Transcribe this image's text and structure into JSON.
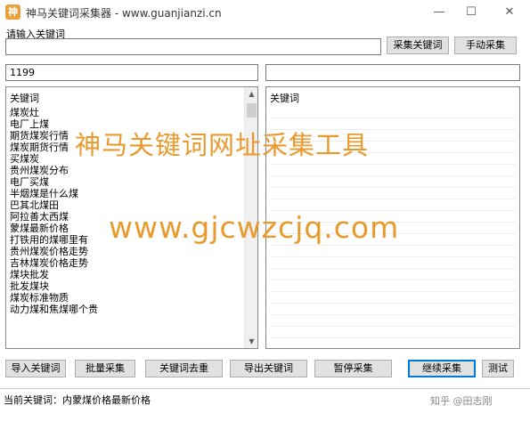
{
  "window": {
    "title": "神马关键词采集器 - www.guanjianzi.cn",
    "icon_glyph": "神",
    "minimize": "—",
    "maximize": "☐",
    "close": "✕"
  },
  "input_section": {
    "label": "请输入关键词",
    "keyword_value": "",
    "collect_keyword_button": "采集关键词",
    "manual_collect_button": "手动采集"
  },
  "counters": {
    "left_count": "1199",
    "right_count": ""
  },
  "left_list": {
    "header": "关键词",
    "items": [
      "煤炭灶",
      "电厂上煤",
      "期货煤炭行情",
      "煤炭期货行情",
      "买煤炭",
      "贵州煤炭分布",
      "电厂买煤",
      "半烟煤是什么煤",
      "巴其北煤田",
      "阿拉善太西煤",
      "蒙煤最新价格",
      "打铁用的煤哪里有",
      "贵州煤炭价格走势",
      "吉林煤炭价格走势",
      "煤块批发",
      "批发煤块",
      "煤炭标准物质",
      "动力煤和焦煤哪个贵"
    ]
  },
  "right_list": {
    "header": "关键词"
  },
  "overlay": {
    "title_watermark": "神马关键词网址采集工具",
    "url_watermark": "www.gjcwzcjq.com",
    "color": "#e89a2c"
  },
  "toolbar": {
    "import_keywords": "导入关键词",
    "batch_collect": "批量采集",
    "dedupe_keywords": "关键词去重",
    "export_keywords": "导出关键词",
    "pause_collect": "暂停采集",
    "continue_collect": "继续采集",
    "test": "测试"
  },
  "status": {
    "current_keyword": "当前关键词：内蒙煤价格最新价格",
    "credit": "知乎 @田志刚"
  }
}
